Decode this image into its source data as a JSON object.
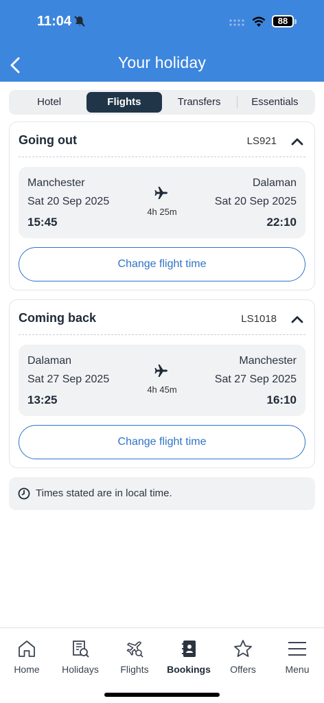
{
  "status_bar": {
    "time": "11:04",
    "battery": "88"
  },
  "header": {
    "title": "Your holiday"
  },
  "tabs": [
    {
      "label": "Hotel"
    },
    {
      "label": "Flights"
    },
    {
      "label": "Transfers"
    },
    {
      "label": "Essentials"
    }
  ],
  "active_tab": "Flights",
  "outbound": {
    "title": "Going out",
    "flight_no": "LS921",
    "from_city": "Manchester",
    "from_date": "Sat 20 Sep 2025",
    "from_time": "15:45",
    "to_city": "Dalaman",
    "to_date": "Sat 20 Sep 2025",
    "to_time": "22:10",
    "duration": "4h 25m",
    "button": "Change flight time"
  },
  "inbound": {
    "title": "Coming back",
    "flight_no": "LS1018",
    "from_city": "Dalaman",
    "from_date": "Sat 27 Sep 2025",
    "from_time": "13:25",
    "to_city": "Manchester",
    "to_date": "Sat 27 Sep 2025",
    "to_time": "16:10",
    "duration": "4h 45m",
    "button": "Change flight time"
  },
  "note": {
    "text": "Times stated are in local time."
  },
  "nav": [
    {
      "label": "Home",
      "icon": "home-icon"
    },
    {
      "label": "Holidays",
      "icon": "holidays-icon"
    },
    {
      "label": "Flights",
      "icon": "flights-icon"
    },
    {
      "label": "Bookings",
      "icon": "bookings-icon"
    },
    {
      "label": "Offers",
      "icon": "star-icon"
    },
    {
      "label": "Menu",
      "icon": "menu-icon"
    }
  ],
  "active_nav": "Bookings",
  "colors": {
    "header": "#3d86dd",
    "active_tab": "#213548",
    "button_border": "#2f73c7"
  }
}
